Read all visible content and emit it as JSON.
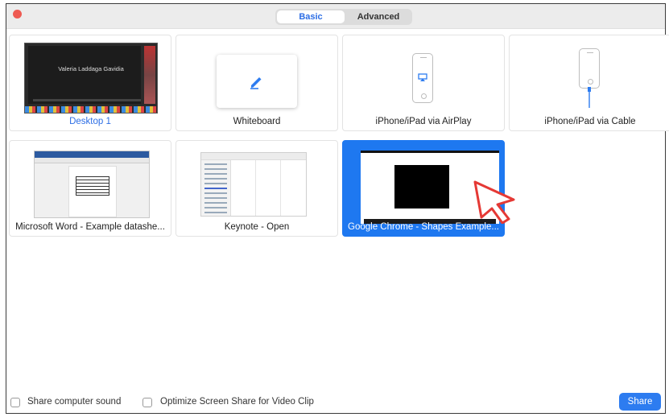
{
  "tabs": {
    "basic": "Basic",
    "advanced": "Advanced"
  },
  "tiles": [
    {
      "label": "Desktop 1",
      "preview_text": "Valeria Laddaga Gavidia"
    },
    {
      "label": "Whiteboard"
    },
    {
      "label": "iPhone/iPad via AirPlay"
    },
    {
      "label": "iPhone/iPad via Cable"
    },
    {
      "label": "Microsoft Word - Example datashe..."
    },
    {
      "label": "Keynote - Open"
    },
    {
      "label": "Google Chrome - Shapes Example..."
    }
  ],
  "selected_tile": "Google Chrome - Shapes Example...",
  "footer": {
    "share_sound": "Share computer sound",
    "optimize_video": "Optimize Screen Share for Video Clip",
    "share_button": "Share"
  },
  "colors": {
    "accent": "#2d7cf0",
    "selected": "#1e78f0",
    "close": "#ee5a52",
    "cursor": "#e53935"
  }
}
